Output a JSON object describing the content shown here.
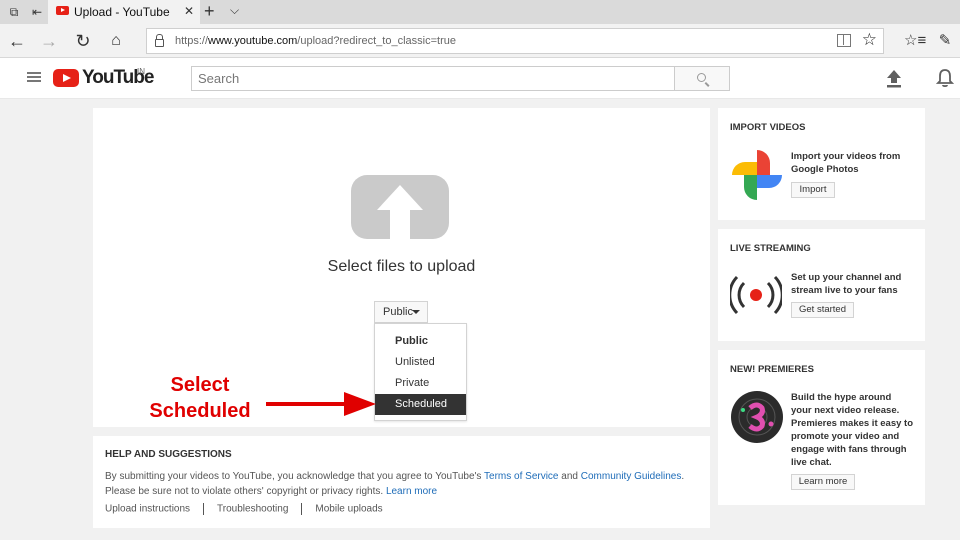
{
  "browser": {
    "tab_title": "Upload - YouTube",
    "tab_close": "✕",
    "new_tab": "+",
    "tab_menu": "⌵",
    "url_prefix": "https://",
    "url_host": "www.youtube.com",
    "url_path": "/upload?redirect_to_classic=true",
    "fav_star": "☆"
  },
  "header": {
    "logo_text": "YouTube",
    "logo_region": "IN",
    "search_placeholder": "Search"
  },
  "upload": {
    "title": "Select files to upload",
    "privacy_selected": "Public",
    "privacy_options": [
      "Public",
      "Unlisted",
      "Private",
      "Scheduled"
    ]
  },
  "annotation": {
    "line1": "Select",
    "line2": "Scheduled"
  },
  "help": {
    "heading": "HELP AND SUGGESTIONS",
    "text_pre": "By submitting your videos to YouTube, you acknowledge that you agree to YouTube's ",
    "tos_link": "Terms of Service",
    "and": " and ",
    "guidelines_link": "Community Guidelines",
    "text_post": ".",
    "line2": "Please be sure not to violate others' copyright or privacy rights. ",
    "learn_more": "Learn more",
    "links": [
      "Upload instructions",
      "Troubleshooting",
      "Mobile uploads"
    ]
  },
  "sidebar": {
    "import": {
      "heading": "IMPORT VIDEOS",
      "text": "Import your videos from Google Photos",
      "button": "Import"
    },
    "live": {
      "heading": "LIVE STREAMING",
      "text": "Set up your channel and stream live to your fans",
      "button": "Get started"
    },
    "premieres": {
      "heading": "NEW! PREMIERES",
      "text": "Build the hype around your next video release. Premieres makes it easy to promote your video and engage with fans through live chat.",
      "button": "Learn more"
    }
  },
  "colors": {
    "brand_red": "#e62117",
    "link_blue": "#1e6cb8",
    "annotation_red": "#e00000",
    "menu_selected_bg": "#333333"
  }
}
